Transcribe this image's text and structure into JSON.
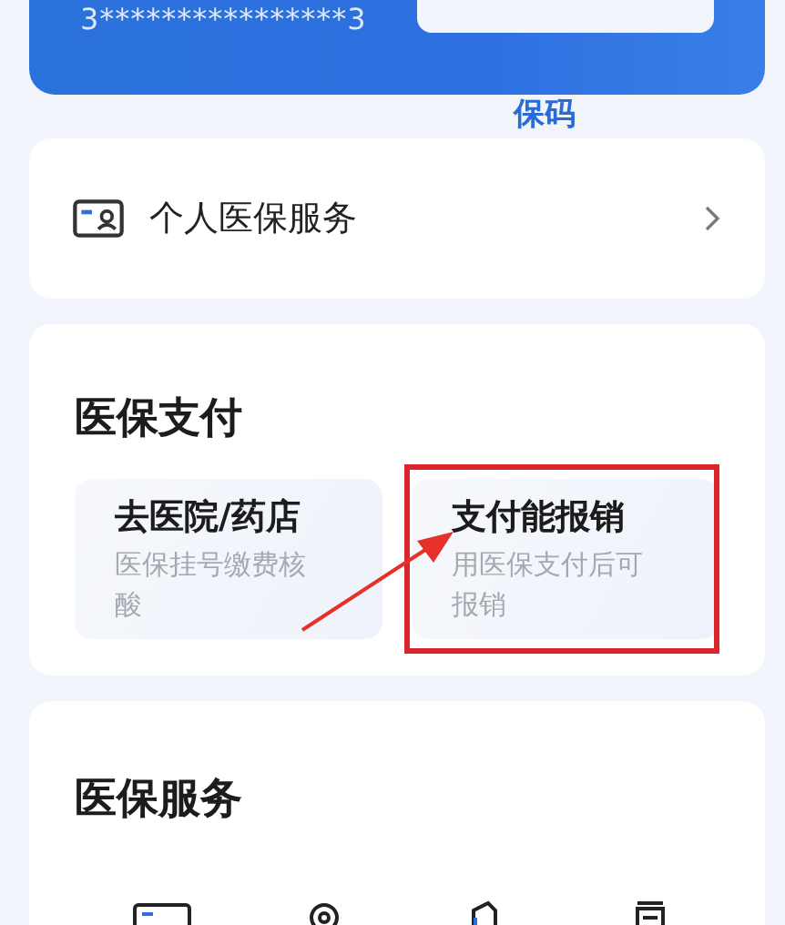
{
  "card": {
    "number": "3****************3",
    "caption": "保码"
  },
  "personal_service": {
    "label": "个人医保服务"
  },
  "payment": {
    "title": "医保支付",
    "tiles": [
      {
        "title": "去医院/药店",
        "subtitle": "医保挂号缴费核酸",
        "highlighted": false
      },
      {
        "title": "支付能报销",
        "subtitle": "用医保支付后可报销",
        "highlighted": true
      }
    ]
  },
  "services": {
    "title": "医保服务"
  }
}
